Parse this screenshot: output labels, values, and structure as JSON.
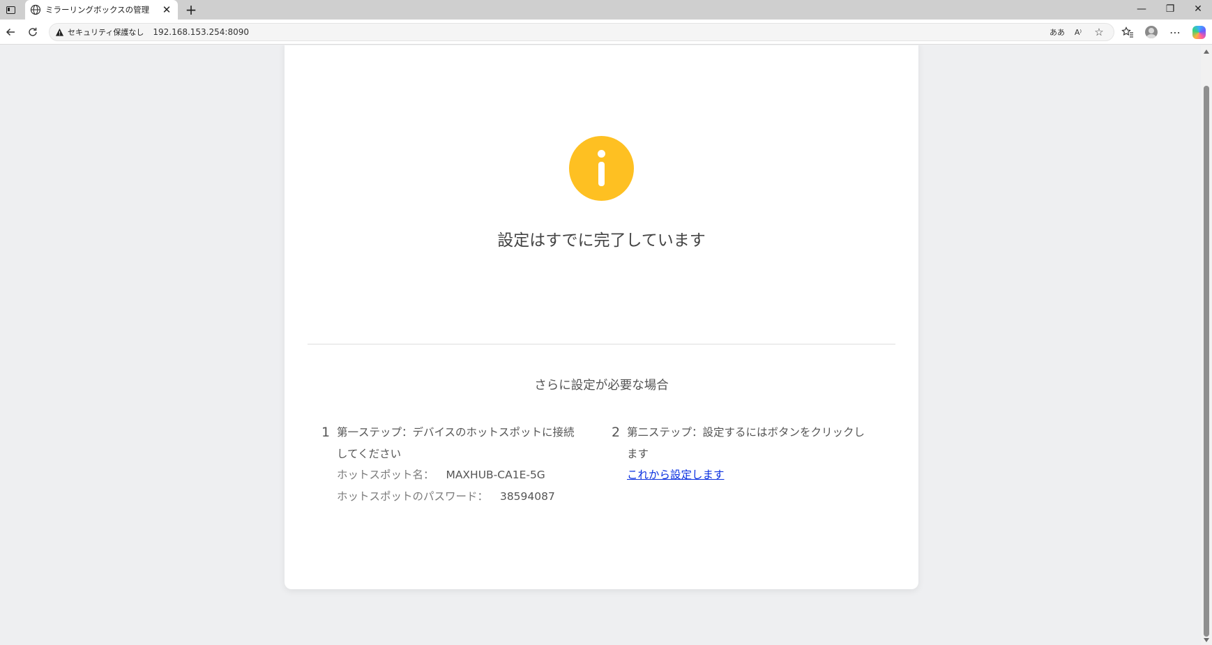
{
  "browser": {
    "tab": {
      "title": "ミラーリングボックスの管理",
      "close_glyph": "✕"
    },
    "new_tab_glyph": "+",
    "window_controls": {
      "minimize": "—",
      "maximize": "❐",
      "close": "✕"
    },
    "address_bar": {
      "security_label": "セキュリティ保護なし",
      "url": "192.168.153.254:8090",
      "translate_glyph": "ああ",
      "read_aloud_glyph": "A⁾",
      "favorite_glyph": "☆"
    },
    "menu_glyph": "⋯"
  },
  "page": {
    "status_title": "設定はすでに完了しています",
    "section_title": "さらに設定が必要な場合",
    "step1": {
      "number": "1",
      "line1": "第一ステップ：デバイスのホットスポットに接続",
      "line2": "してください",
      "hotspot_name_label": "ホットスポット名：",
      "hotspot_name_value": "MAXHUB-CA1E-5G",
      "hotspot_password_label": "ホットスポットのパスワード：",
      "hotspot_password_value": "38594087"
    },
    "step2": {
      "number": "2",
      "line1": "第二ステップ：設定するにはボタンをクリックし",
      "line2": "ます",
      "link_label": "これから設定します"
    }
  },
  "colors": {
    "info_icon": "#fec022",
    "link": "#0b31e0",
    "page_background": "#eeeff1"
  }
}
